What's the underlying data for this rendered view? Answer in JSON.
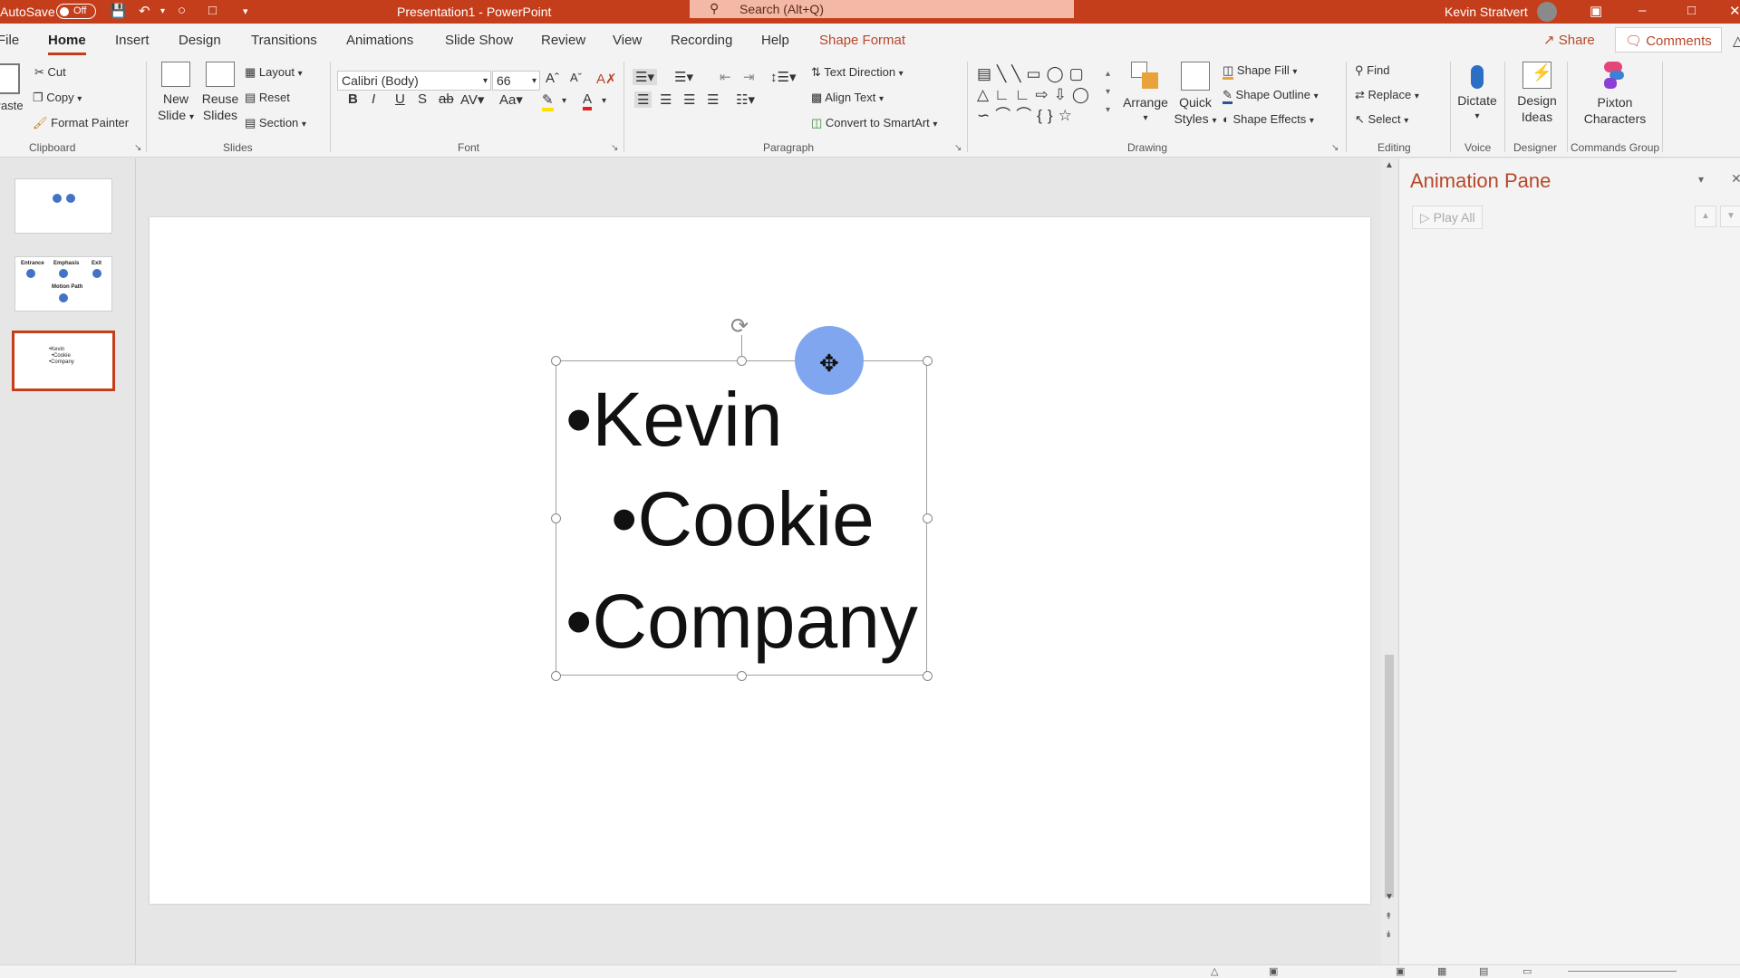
{
  "titlebar": {
    "autosave_label": "AutoSave",
    "autosave_state": "Off",
    "doc_title": "Presentation1  -  PowerPoint",
    "search_placeholder": "Search (Alt+Q)",
    "user_name": "Kevin Stratvert"
  },
  "tabs": [
    {
      "label": "File"
    },
    {
      "label": "Home"
    },
    {
      "label": "Insert"
    },
    {
      "label": "Design"
    },
    {
      "label": "Transitions"
    },
    {
      "label": "Animations"
    },
    {
      "label": "Slide Show"
    },
    {
      "label": "Review"
    },
    {
      "label": "View"
    },
    {
      "label": "Recording"
    },
    {
      "label": "Help"
    },
    {
      "label": "Shape Format"
    }
  ],
  "share_label": "Share",
  "comments_label": "Comments",
  "ribbon": {
    "clipboard": {
      "paste": "Paste",
      "cut": "Cut",
      "copy": "Copy",
      "format_painter": "Format Painter",
      "group": "Clipboard"
    },
    "slides": {
      "new_slide": "New",
      "new_slide2": "Slide",
      "reuse": "Reuse",
      "reuse2": "Slides",
      "layout": "Layout",
      "reset": "Reset",
      "section": "Section",
      "group": "Slides"
    },
    "font": {
      "font_name": "Calibri (Body)",
      "font_size": "66",
      "group": "Font"
    },
    "paragraph": {
      "text_direction": "Text Direction",
      "align_text": "Align Text",
      "smartart": "Convert to SmartArt",
      "group": "Paragraph"
    },
    "drawing": {
      "arrange": "Arrange",
      "quick": "Quick",
      "styles": "Styles",
      "fill": "Shape Fill",
      "outline": "Shape Outline",
      "effects": "Shape Effects",
      "group": "Drawing"
    },
    "editing": {
      "find": "Find",
      "replace": "Replace",
      "select": "Select",
      "group": "Editing"
    },
    "voice": {
      "dictate": "Dictate",
      "group": "Voice"
    },
    "designer": {
      "design": "Design",
      "ideas": "Ideas",
      "group": "Designer"
    },
    "commands": {
      "pixton": "Pixton",
      "characters": "Characters",
      "group": "Commands Group"
    }
  },
  "thumbnails": {
    "slide2": {
      "entrance": "Entrance",
      "emphasis": "Emphasis",
      "exit": "Exit",
      "motion": "Motion Path"
    },
    "slide3": [
      "•Kevin",
      "•Cookie",
      "•Company"
    ]
  },
  "slide": {
    "bullets": [
      "•Kevin",
      "•Cookie",
      "•Company"
    ]
  },
  "animation_pane": {
    "title": "Animation Pane",
    "play_all": "Play All"
  },
  "colors": {
    "accent": "#c43e1c",
    "dot": "#4472c4",
    "cursor_highlight": "#7fa6ef"
  }
}
